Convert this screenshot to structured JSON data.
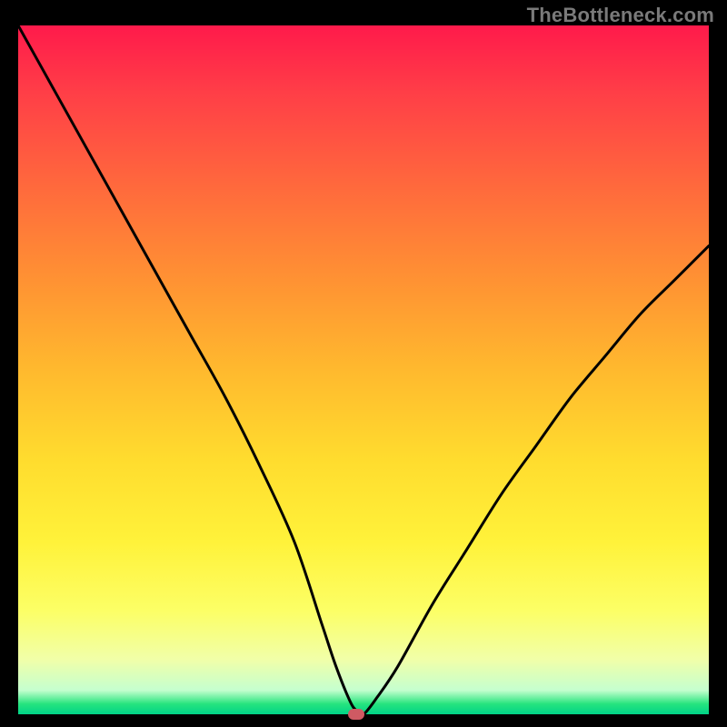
{
  "watermark": "TheBottleneck.com",
  "chart_data": {
    "type": "line",
    "title": "",
    "xlabel": "",
    "ylabel": "",
    "xlim": [
      0,
      100
    ],
    "ylim": [
      0,
      100
    ],
    "grid": false,
    "legend": false,
    "series": [
      {
        "name": "bottleneck-curve",
        "x": [
          0,
          5,
          10,
          15,
          20,
          25,
          30,
          35,
          40,
          44,
          46,
          48,
          49,
          50,
          52,
          55,
          60,
          65,
          70,
          75,
          80,
          85,
          90,
          95,
          100
        ],
        "y": [
          100,
          91,
          82,
          73,
          64,
          55,
          46,
          36,
          25,
          13,
          7,
          2,
          0.5,
          0,
          2.5,
          7,
          16,
          24,
          32,
          39,
          46,
          52,
          58,
          63,
          68
        ]
      }
    ],
    "marker": {
      "x": 49,
      "y": 0,
      "color": "#cf5a63"
    },
    "background_gradient": {
      "direction": "vertical",
      "stops": [
        {
          "pos": 0.0,
          "color": "#ff1a4b"
        },
        {
          "pos": 0.5,
          "color": "#ffdc2e"
        },
        {
          "pos": 0.92,
          "color": "#f1ffa8"
        },
        {
          "pos": 1.0,
          "color": "#00d387"
        }
      ]
    }
  }
}
